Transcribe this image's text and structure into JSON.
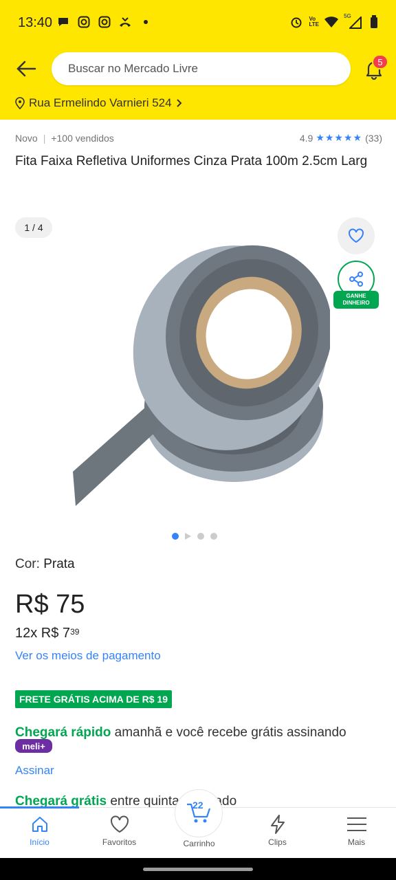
{
  "status_bar": {
    "time": "13:40",
    "left_icons": [
      "chat-icon",
      "instagram-icon",
      "instagram-icon",
      "missed-call-icon",
      "dot-icon"
    ],
    "right_icons": [
      "alarm-icon",
      "volte-icon",
      "wifi-icon",
      "signal-5g-icon",
      "battery-icon"
    ],
    "volte_text": "Vo\nLTE",
    "network_text": "5G"
  },
  "header": {
    "search_placeholder": "Buscar no Mercado Livre",
    "notifications_count": "5",
    "address": "Rua Ermelindo Varnieri 524"
  },
  "product": {
    "condition": "Novo",
    "sold": "+100 vendidos",
    "rating": "4.9",
    "stars": "★★★★★",
    "reviews": "(33)",
    "title": "Fita Faixa Refletiva Uniformes Cinza Prata 100m 2.5cm Larg",
    "image_counter": "1 / 4",
    "share_label": "GANHE DINHEIRO",
    "carousel_total": 4,
    "carousel_active": 1,
    "color_label": "Cor:",
    "color_value": "Prata",
    "price": "R$ 75",
    "installments_prefix": "12x R$ 7",
    "installments_cents": "39",
    "payment_link": "Ver os meios de pagamento"
  },
  "shipping": {
    "free_badge": "FRETE GRÁTIS ACIMA DE R$ 19",
    "fast_label": "Chegará rápido",
    "fast_text": " amanhã e você recebe grátis assinando",
    "meli_badge": "meli+",
    "subscribe_link": "Assinar",
    "free_label": "Chegará grátis",
    "free_text": " entre quinta e sábado"
  },
  "bottom_nav": {
    "home": "Início",
    "favorites": "Favoritos",
    "cart": "Carrinho",
    "cart_count": "22",
    "clips": "Clips",
    "more": "Mais"
  },
  "colors": {
    "brand_yellow": "#ffe600",
    "accent_blue": "#3483fa",
    "success_green": "#00a650",
    "meli_purple": "#6d2ea3",
    "badge_red": "#f23d4f"
  }
}
